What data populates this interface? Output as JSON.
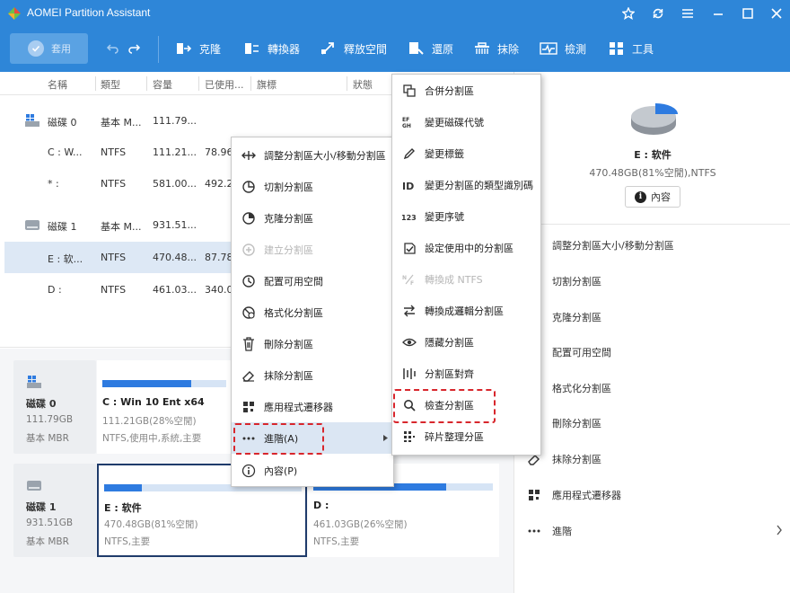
{
  "app": {
    "title": "AOMEI Partition Assistant"
  },
  "toolbar": {
    "apply": "套用",
    "items": [
      "克隆",
      "轉換器",
      "釋放空間",
      "還原",
      "抹除",
      "檢測",
      "工具"
    ]
  },
  "table": {
    "headers": [
      "名稱",
      "類型",
      "容量",
      "已使用...",
      "旗標",
      "狀態"
    ],
    "rows": [
      {
        "name": "磁碟 0",
        "type": "基本 M...",
        "cap": "111.79...",
        "used": "",
        "disk": true
      },
      {
        "name": "C : W...",
        "type": "NTFS",
        "cap": "111.21...",
        "used": "78.96"
      },
      {
        "name": "* :",
        "type": "NTFS",
        "cap": "581.00...",
        "used": "492.2"
      },
      {
        "name": "磁碟 1",
        "type": "基本 M...",
        "cap": "931.51...",
        "used": "",
        "disk": true
      },
      {
        "name": "E : 软...",
        "type": "NTFS",
        "cap": "470.48...",
        "used": "87.78",
        "selected": true
      },
      {
        "name": "D :",
        "type": "NTFS",
        "cap": "461.03...",
        "used": "340.0"
      }
    ]
  },
  "diskmap": {
    "disks": [
      {
        "name": "磁碟 0",
        "size": "111.79GB",
        "kind": "基本 MBR",
        "parts": [
          {
            "name": "C : Win 10 Ent x64",
            "size": "111.21GB(28%空閒)",
            "info": "NTFS,使用中,系統,主要",
            "fill": 0.72
          }
        ]
      },
      {
        "name": "磁碟 1",
        "size": "931.51GB",
        "kind": "基本 MBR",
        "parts": [
          {
            "name": "E : 软件",
            "size": "470.48GB(81%空閒)",
            "info": "NTFS,主要",
            "fill": 0.19
          },
          {
            "name": "D :",
            "size": "461.03GB(26%空閒)",
            "info": "NTFS,主要",
            "fill": 0.74
          }
        ]
      }
    ]
  },
  "rpanel": {
    "title": "E : 软件",
    "sub": "470.48GB(81%空閒),NTFS",
    "props_btn": "內容",
    "ops": [
      "調整分割區大小/移動分割區",
      "切割分割區",
      "克隆分割區",
      "配置可用空間",
      "格式化分割區",
      "刪除分割區",
      "抹除分割區",
      "應用程式遷移器",
      "進階"
    ]
  },
  "menu1": {
    "items": [
      {
        "label": "調整分割區大小/移動分割區"
      },
      {
        "label": "切割分割區"
      },
      {
        "label": "克隆分割區"
      },
      {
        "label": "建立分割區",
        "disabled": true
      },
      {
        "label": "配置可用空間"
      },
      {
        "label": "格式化分割區"
      },
      {
        "label": "刪除分割區"
      },
      {
        "label": "抹除分割區"
      },
      {
        "label": "應用程式遷移器"
      },
      {
        "label": "進階(A)",
        "highlighted": true
      },
      {
        "label": "內容(P)"
      }
    ]
  },
  "menu2": {
    "items": [
      {
        "label": "合併分割區"
      },
      {
        "label": "變更磁碟代號"
      },
      {
        "label": "變更標籤"
      },
      {
        "label": "變更分割區的類型識別碼"
      },
      {
        "label": "變更序號"
      },
      {
        "label": "設定使用中的分割區"
      },
      {
        "label": "轉換成 NTFS",
        "disabled": true
      },
      {
        "label": "轉換成邏輯分割區"
      },
      {
        "label": "隱藏分割區"
      },
      {
        "label": "分割區對齊"
      },
      {
        "label": "檢查分割區"
      },
      {
        "label": "碎片整理分區"
      }
    ]
  },
  "colors": {
    "accent": "#2e86d8",
    "highlight": "#d8262c",
    "selected_bg": "#dde8f5"
  }
}
